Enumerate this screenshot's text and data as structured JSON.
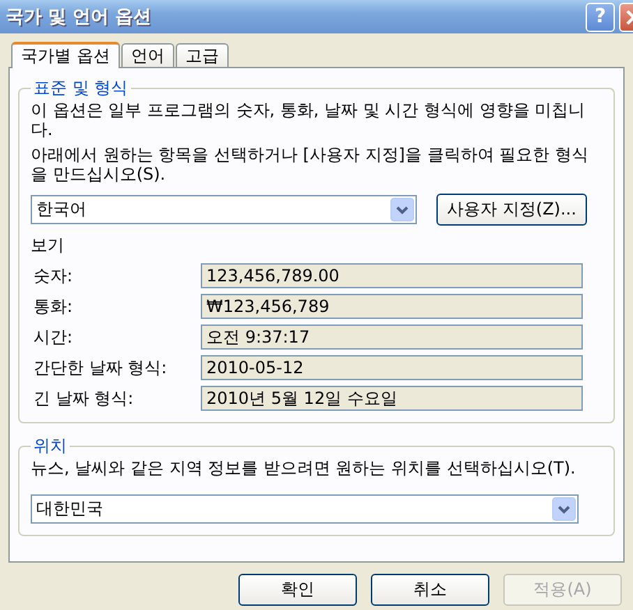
{
  "window": {
    "title": "국가 및 언어 옵션",
    "help_button": "?"
  },
  "tabs": [
    {
      "label": "국가별 옵션",
      "selected": true
    },
    {
      "label": "언어",
      "selected": false
    },
    {
      "label": "고급",
      "selected": false
    }
  ],
  "standards_group": {
    "title": "표준 및 형식",
    "description": "이 옵션은 일부 프로그램의 숫자, 통화, 날짜 및 시간 형식에 영향을 미칩니다.",
    "instruction": "아래에서 원하는 항목을 선택하거나 [사용자 지정]을 클릭하여 필요한 형식을 만드십시오(S).",
    "format_select": "한국어",
    "customize_button": "사용자 지정(Z)...",
    "preview_label": "보기",
    "samples": [
      {
        "label": "숫자:",
        "value": "123,456,789.00"
      },
      {
        "label": "통화:",
        "value": "₩123,456,789"
      },
      {
        "label": "시간:",
        "value": "오전 9:37:17"
      },
      {
        "label": "간단한 날짜 형식:",
        "value": "2010-05-12"
      },
      {
        "label": "긴 날짜 형식:",
        "value": "2010년 5월 12일 수요일"
      }
    ]
  },
  "location_group": {
    "title": "위치",
    "description": "뉴스, 날씨와 같은 지역 정보를 받으려면 원하는 위치를 선택하십시오(T).",
    "location_select": "대한민국"
  },
  "buttons": [
    {
      "label": "확인",
      "disabled": false
    },
    {
      "label": "취소",
      "disabled": false
    },
    {
      "label": "적용(A)",
      "disabled": true
    }
  ]
}
